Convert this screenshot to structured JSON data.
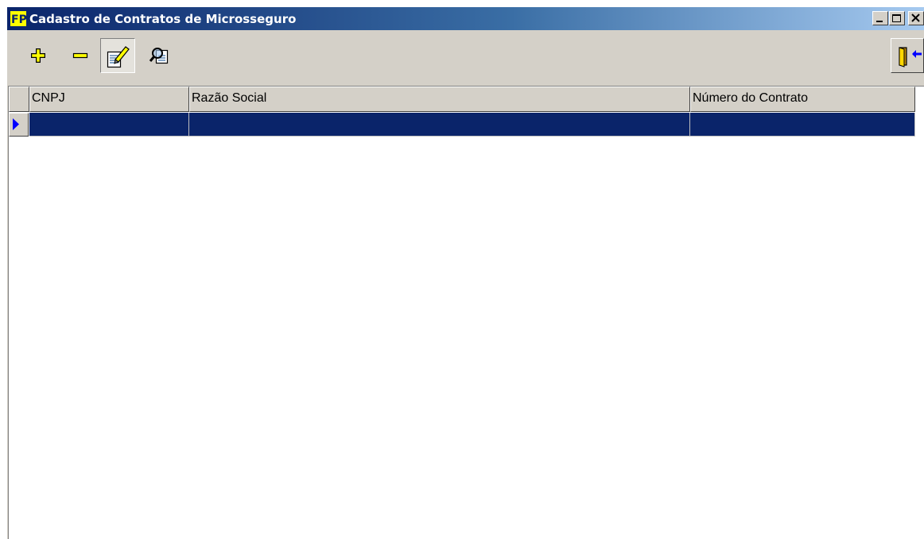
{
  "window": {
    "title": "Cadastro de Contratos de Microsseguro",
    "app_icon_text": "FP",
    "controls": [
      "minimize",
      "maximize",
      "close"
    ]
  },
  "toolbar": {
    "buttons": [
      {
        "name": "add",
        "icon": "plus-icon",
        "color": "#ffff00"
      },
      {
        "name": "remove",
        "icon": "minus-icon",
        "color": "#ffff00"
      },
      {
        "name": "edit",
        "icon": "edit-document-icon",
        "state": "pressed"
      },
      {
        "name": "search",
        "icon": "search-document-icon"
      },
      {
        "name": "exit",
        "icon": "exit-door-icon"
      }
    ]
  },
  "grid": {
    "columns": [
      "CNPJ",
      "Razão Social",
      "Número do Contrato"
    ],
    "rows": [
      {
        "cnpj": "",
        "razao_social": "",
        "numero_contrato": "",
        "selected": true
      }
    ]
  },
  "colors": {
    "titlebar_start": "#0a246a",
    "titlebar_end": "#a6caf0",
    "selection": "#0a246a",
    "face": "#d4d0c8",
    "row_indicator": "#0000ff"
  }
}
